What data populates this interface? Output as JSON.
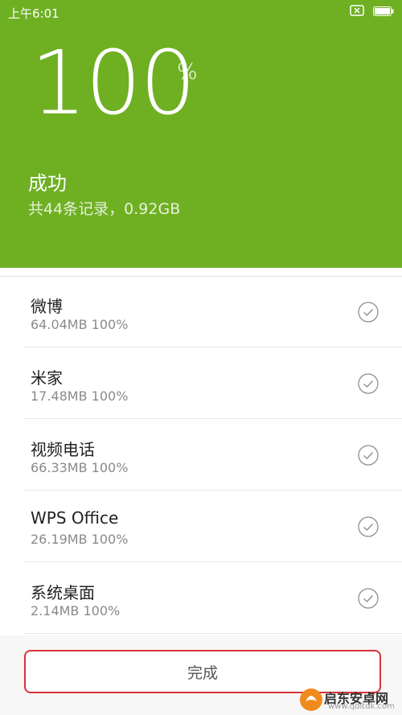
{
  "status_bar": {
    "time": "上午6:01",
    "notification_icon": "close-box-icon",
    "battery_icon": "battery-icon"
  },
  "header": {
    "progress_value": "100",
    "progress_unit": "%",
    "progress_fraction": 1.0,
    "title": "成功",
    "summary": "共44条记录，0.92GB",
    "background_color": "#6fb023"
  },
  "list": {
    "items": [
      {
        "name": "微博",
        "detail": "64.04MB 100%",
        "icon": "check-circle-icon"
      },
      {
        "name": "米家",
        "detail": "17.48MB 100%",
        "icon": "check-circle-icon"
      },
      {
        "name": "视频电话",
        "detail": "66.33MB 100%",
        "icon": "check-circle-icon"
      },
      {
        "name": "WPS Office",
        "detail": "26.19MB 100%",
        "icon": "check-circle-icon"
      },
      {
        "name": "系统桌面",
        "detail": "2.14MB 100%",
        "icon": "check-circle-icon"
      }
    ]
  },
  "footer": {
    "done_label": "完成",
    "highlight_color": "#d9333a"
  },
  "watermark": {
    "name": "启东安卓网",
    "url": "www.qdltdk.com"
  }
}
